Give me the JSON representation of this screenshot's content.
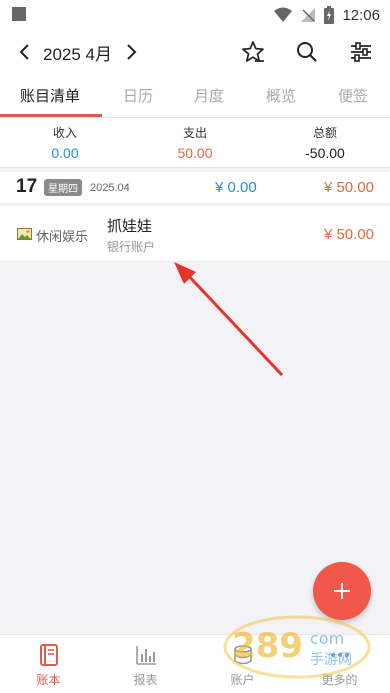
{
  "status_bar": {
    "time": "12:06"
  },
  "header": {
    "title": "2025 4月"
  },
  "tabs": [
    {
      "label": "账目清单"
    },
    {
      "label": "日历"
    },
    {
      "label": "月度"
    },
    {
      "label": "概览"
    },
    {
      "label": "便签"
    }
  ],
  "summary": {
    "income_label": "收入",
    "income_value": "0.00",
    "expense_label": "支出",
    "expense_value": "50.00",
    "total_label": "总额",
    "total_value": "-50.00"
  },
  "day_group": {
    "day": "17",
    "weekday": "星期四",
    "month": "2025.04",
    "income": "¥ 0.00",
    "expense": "¥ 50.00"
  },
  "entry": {
    "category": "休闲娱乐",
    "title": "抓娃娃",
    "account": "银行账户",
    "amount": "¥ 50.00"
  },
  "bottom_nav": [
    {
      "label": "账本"
    },
    {
      "label": "报表"
    },
    {
      "label": "账户"
    },
    {
      "label": "更多的"
    }
  ],
  "colors": {
    "accent": "#e25b4e",
    "income": "#2a8fd1",
    "expense": "#e06a3c",
    "fab": "#f1584a"
  }
}
